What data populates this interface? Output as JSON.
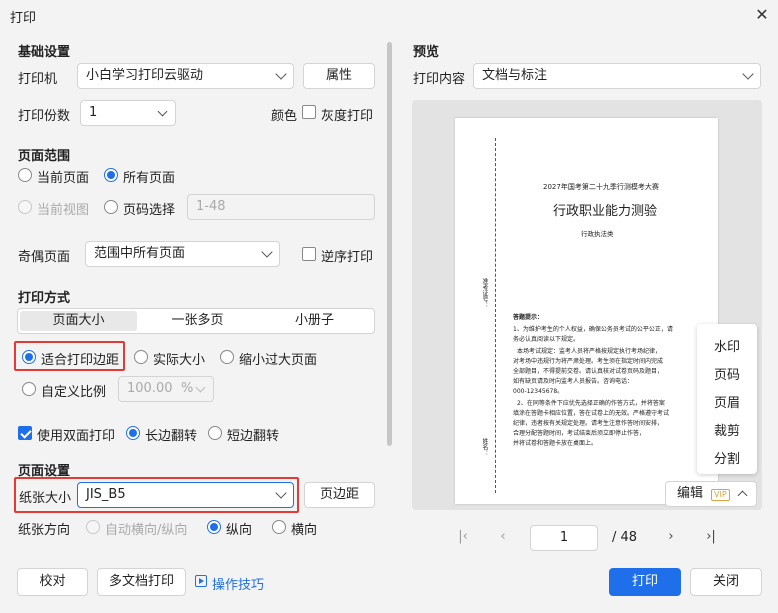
{
  "window": {
    "title": "打印"
  },
  "basic": {
    "heading": "基础设置",
    "printer_label": "打印机",
    "printer_value": "小白学习打印云驱动",
    "properties_label": "属性",
    "copies_label": "打印份数",
    "copies_value": "1",
    "color_label": "颜色",
    "grayscale_label": "灰度打印"
  },
  "range": {
    "heading": "页面范围",
    "current_page": "当前页面",
    "all_pages": "所有页面",
    "current_view": "当前视图",
    "page_select": "页码选择",
    "page_select_value": "1-48",
    "odd_even_label": "奇偶页面",
    "odd_even_value": "范围中所有页面",
    "reverse_label": "逆序打印"
  },
  "method": {
    "heading": "打印方式",
    "tabs": [
      "页面大小",
      "一张多页",
      "小册子"
    ],
    "fit_margins": "适合打印边距",
    "actual_size": "实际大小",
    "shrink_large": "缩小过大页面",
    "custom_scale": "自定义比例",
    "scale_value": "100.00",
    "scale_unit": "%",
    "duplex_label": "使用双面打印",
    "long_edge": "长边翻转",
    "short_edge": "短边翻转"
  },
  "page_setup": {
    "heading": "页面设置",
    "paper_size_label": "纸张大小",
    "paper_size_value": "JIS_B5",
    "margin_label": "页边距",
    "orientation_label": "纸张方向",
    "auto_orient": "自动横向/纵向",
    "portrait": "纵向",
    "landscape": "横向"
  },
  "footer": {
    "proof": "校对",
    "multi_doc": "多文档打印",
    "tips": "操作技巧",
    "print": "打印",
    "close": "关闭"
  },
  "preview": {
    "heading": "预览",
    "content_label": "打印内容",
    "content_value": "文档与标注",
    "side_menu": [
      "水印",
      "页码",
      "页眉",
      "裁剪",
      "分割"
    ],
    "edit_label": "编辑",
    "vip": "VIP",
    "current_page": "1",
    "total_pages": "/ 48"
  },
  "doc": {
    "subtitle": "2027年国考第二十九季行测模考大赛",
    "title": "行政职业能力测验",
    "category": "行政执法类",
    "side_label1": "准考证号：",
    "side_label2": "姓名：",
    "notice_heading": "答题提示：",
    "notice_lines": [
      "1、为维护考生的个人权益，确保公务员考试的公平公正，请",
      "务必认真阅读以下规定。",
      "本场考试规定：监考人员将严格按规定执行考场纪律，",
      "对考场中违规行为将严肃处理。考生须在指定时间内完成",
      "全部题目，不得提前交卷。请认真核对试卷页码及题目，",
      "如有缺页请及时向监考人员报告。咨询电话：",
      "000-12345678。",
      "2、在同等条件下应优先选择正确的作答方式，并将答案",
      "填涂在答题卡相应位置，答在试卷上的无效。严格遵守考试",
      "纪律，违者按有关规定处理。请考生注意作答时间安排，",
      "合理分配答题时间，考试结束后须立即停止作答，",
      "并将试卷和答题卡放在桌面上。"
    ]
  },
  "colors": {
    "accent": "#1f6feb",
    "highlight": "#e53935"
  }
}
